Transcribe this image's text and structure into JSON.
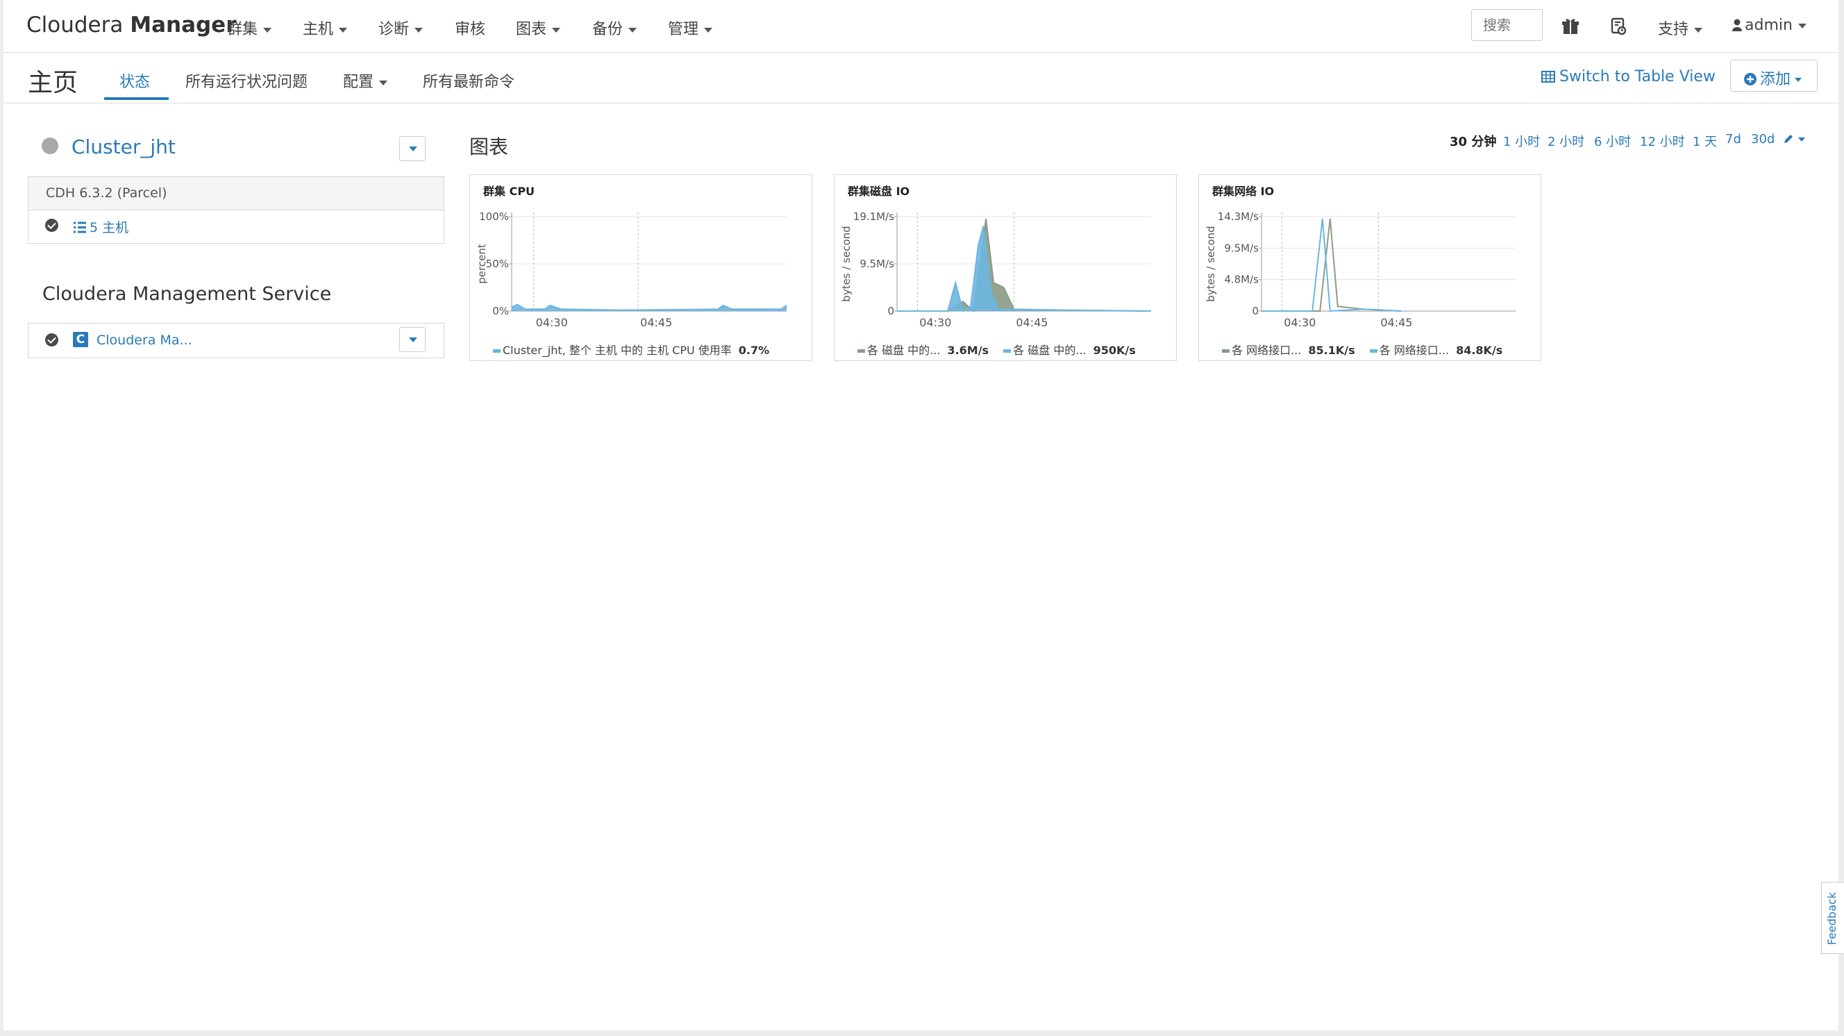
{
  "brand": {
    "light": "Cloudera",
    "bold": "Manager"
  },
  "nav": {
    "clusters": "群集",
    "hosts": "主机",
    "diagnostics": "诊断",
    "audits": "审核",
    "charts": "图表",
    "backup": "备份",
    "admin_menu": "管理",
    "search_placeholder": "搜索",
    "support": "支持",
    "user": "admin"
  },
  "header": {
    "title": "主页",
    "tabs": [
      "状态",
      "所有运行状况问题",
      "配置",
      "所有最新命令"
    ],
    "switch_view": "Switch to Table View",
    "add": "添加"
  },
  "cluster": {
    "name": "Cluster_jht",
    "version": "CDH 6.3.2 (Parcel)",
    "hosts_link": "5 主机"
  },
  "cms": {
    "title": "Cloudera Management Service",
    "item": "Cloudera Ma..."
  },
  "charts_section": {
    "title": "图表",
    "ranges": [
      "30 分钟",
      "1 小时",
      "2 小时",
      "6 小时",
      "12 小时",
      "1 天",
      "7d",
      "30d"
    ],
    "active_range": "30 分钟"
  },
  "chart_data": [
    {
      "type": "area",
      "title": "群集 CPU",
      "ylabel": "percent",
      "y_ticks": [
        "100%",
        "50%",
        "0%"
      ],
      "x_ticks": [
        "04:30",
        "04:45"
      ],
      "series": [
        {
          "name": "Cluster_jht, 整个 主机 中的 主机 CPU 使用率",
          "value_label": "0.7%",
          "color": "#6bb6e0",
          "points": [
            [
              0.0,
              0.04
            ],
            [
              0.02,
              0.07
            ],
            [
              0.05,
              0.02
            ],
            [
              0.12,
              0.02
            ],
            [
              0.14,
              0.06
            ],
            [
              0.18,
              0.02
            ],
            [
              0.4,
              0.01
            ],
            [
              0.75,
              0.02
            ],
            [
              0.77,
              0.06
            ],
            [
              0.8,
              0.02
            ],
            [
              0.98,
              0.02
            ],
            [
              1.0,
              0.06
            ]
          ]
        }
      ]
    },
    {
      "type": "area",
      "title": "群集磁盘 IO",
      "ylabel": "bytes / second",
      "y_ticks": [
        "19.1M/s",
        "9.5M/s",
        "0"
      ],
      "x_ticks": [
        "04:30",
        "04:45"
      ],
      "series": [
        {
          "name": "各 磁盘 中的...",
          "value_label": "3.6M/s",
          "color": "#8b9b85",
          "points": [
            [
              0.0,
              0.0
            ],
            [
              0.2,
              0.0
            ],
            [
              0.26,
              0.1
            ],
            [
              0.3,
              0.0
            ],
            [
              0.33,
              0.55
            ],
            [
              0.35,
              0.98
            ],
            [
              0.38,
              0.3
            ],
            [
              0.42,
              0.25
            ],
            [
              0.46,
              0.02
            ],
            [
              0.6,
              0.01
            ],
            [
              1.0,
              0.0
            ]
          ]
        },
        {
          "name": "各 磁盘 中的...",
          "value_label": "950K/s",
          "color": "#6bb6e0",
          "points": [
            [
              0.0,
              0.0
            ],
            [
              0.2,
              0.0
            ],
            [
              0.23,
              0.3
            ],
            [
              0.26,
              0.0
            ],
            [
              0.29,
              0.05
            ],
            [
              0.32,
              0.7
            ],
            [
              0.34,
              0.9
            ],
            [
              0.37,
              0.2
            ],
            [
              0.4,
              0.02
            ],
            [
              1.0,
              0.0
            ]
          ]
        }
      ]
    },
    {
      "type": "line",
      "title": "群集网络 IO",
      "ylabel": "bytes / second",
      "y_ticks": [
        "14.3M/s",
        "9.5M/s",
        "4.8M/s",
        "0"
      ],
      "x_ticks": [
        "04:30",
        "04:45"
      ],
      "series": [
        {
          "name": "各 网络接口...",
          "value_label": "85.1K/s",
          "color": "#8b9b85",
          "points": [
            [
              0.0,
              0.0
            ],
            [
              0.2,
              0.0
            ],
            [
              0.23,
              0.0
            ],
            [
              0.27,
              0.98
            ],
            [
              0.3,
              0.05
            ],
            [
              0.4,
              0.02
            ],
            [
              0.55,
              0.0
            ]
          ]
        },
        {
          "name": "各 网络接口...",
          "value_label": "84.8K/s",
          "color": "#6bb6e0",
          "points": [
            [
              0.0,
              0.0
            ],
            [
              0.2,
              0.0
            ],
            [
              0.24,
              0.98
            ],
            [
              0.27,
              0.0
            ],
            [
              0.4,
              0.02
            ],
            [
              0.55,
              0.0
            ]
          ]
        }
      ]
    }
  ],
  "feedback": "Feedback",
  "colors": {
    "link": "#2a7ab8",
    "status_gray": "#a7a9a7"
  }
}
